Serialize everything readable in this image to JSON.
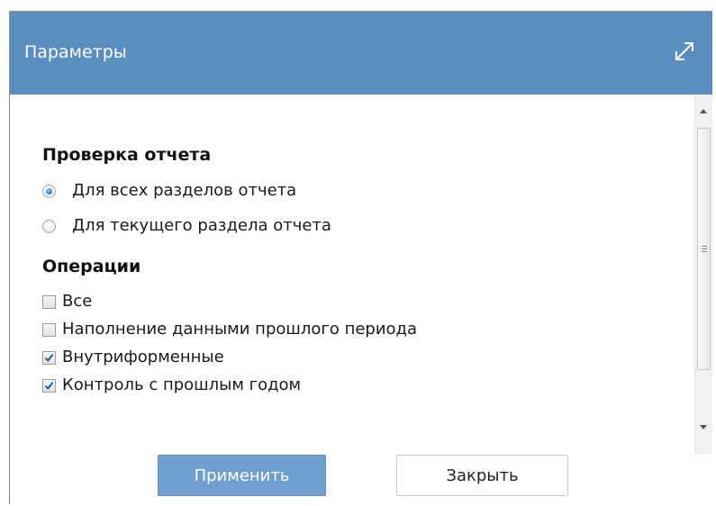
{
  "dialog": {
    "title": "Параметры",
    "expand_icon": "expand-diagonal-arrows-icon"
  },
  "report_check": {
    "heading": "Проверка отчета",
    "options": [
      {
        "label": "Для всех разделов отчета",
        "selected": true
      },
      {
        "label": "Для текущего раздела отчета",
        "selected": false
      }
    ]
  },
  "operations": {
    "heading": "Операции",
    "items": [
      {
        "label": "Все",
        "checked": false
      },
      {
        "label": "Наполнение данными прошлого периода",
        "checked": false
      },
      {
        "label": "Внутриформенные",
        "checked": true
      },
      {
        "label": "Контроль с прошлым годом",
        "checked": true
      }
    ]
  },
  "buttons": {
    "apply_label": "Применить",
    "close_label": "Закрыть"
  },
  "colors": {
    "header": "#5b8ec0",
    "apply_button": "#6f9fce"
  }
}
